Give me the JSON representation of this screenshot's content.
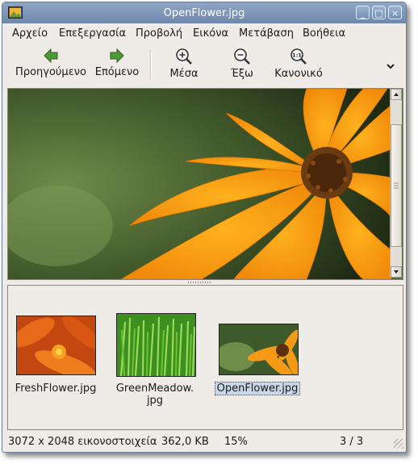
{
  "window": {
    "title": "OpenFlower.jpg",
    "controls": {
      "minimize": "_",
      "maximize": "□",
      "close": "×"
    },
    "app_icon": "image-viewer-icon"
  },
  "menubar": {
    "items": [
      "Αρχείο",
      "Επεξεργασία",
      "Προβολή",
      "Εικόνα",
      "Μετάβαση",
      "Βοήθεια"
    ]
  },
  "toolbar": {
    "previous_label": "Προηγούμενο",
    "next_label": "Επόμενο",
    "zoom_in_label": "Μέσα",
    "zoom_out_label": "Έξω",
    "normal_label": "Κανονικό",
    "normal_icon_text": "1:1",
    "more_icon": "chevron-down-icon"
  },
  "gallery": {
    "items": [
      {
        "label": "FreshFlower.jpg",
        "selected": false
      },
      {
        "label_line1": "GreenMeadow.",
        "label_line2": "jpg",
        "selected": false
      },
      {
        "label": "OpenFlower.jpg",
        "selected": true
      }
    ]
  },
  "statusbar": {
    "dimensions": "3072 x 2048 εικονοστοιχεία",
    "size": "362,0 KB",
    "zoom": "15%",
    "position": "3 / 3"
  },
  "colors": {
    "titlebar": "#7a93b5",
    "window_bg": "#efebe7",
    "selection": "#c9d7eb",
    "arrow_green": "#3f8a2c"
  }
}
